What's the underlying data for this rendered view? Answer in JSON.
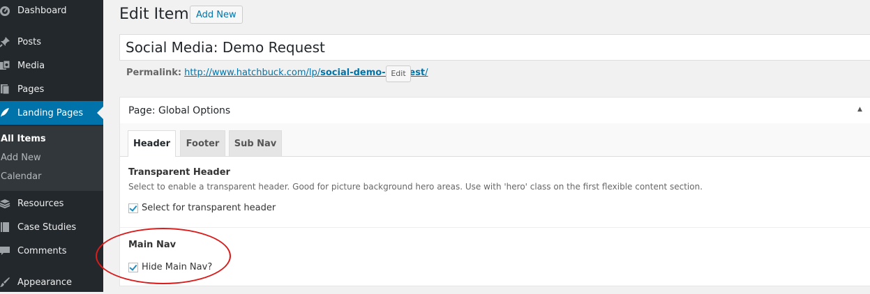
{
  "sidebar": {
    "items": [
      {
        "label": "Dashboard",
        "icon": "dashboard-icon"
      },
      {
        "label": "Posts",
        "icon": "pin-icon"
      },
      {
        "label": "Media",
        "icon": "media-icon"
      },
      {
        "label": "Pages",
        "icon": "pages-icon"
      },
      {
        "label": "Landing Pages",
        "icon": "feather-icon"
      },
      {
        "label": "Resources",
        "icon": "layers-icon"
      },
      {
        "label": "Case Studies",
        "icon": "book-icon"
      },
      {
        "label": "Comments",
        "icon": "comment-icon"
      },
      {
        "label": "Appearance",
        "icon": "brush-icon"
      }
    ],
    "submenu": [
      "All Items",
      "Add New",
      "Calendar"
    ]
  },
  "header": {
    "title": "Edit Item",
    "add_new": "Add New"
  },
  "post": {
    "title_value": "Social Media: Demo Request",
    "permalink_label": "Permalink:",
    "permalink_url": "http://www.hatchbuck.com/lp/",
    "permalink_slug": "social-demo-request",
    "permalink_trailing": "/",
    "edit_label": "Edit"
  },
  "options_box": {
    "title": "Page: Global Options",
    "tabs": [
      "Header",
      "Footer",
      "Sub Nav"
    ],
    "transparent_header": {
      "label": "Transparent Header",
      "description": "Select to enable a transparent header. Good for picture background hero areas. Use with 'hero' class on the first flexible content section.",
      "checkbox_label": "Select for transparent header",
      "checked": true
    },
    "main_nav": {
      "label": "Main Nav",
      "checkbox_label": "Hide Main Nav?",
      "checked": true
    }
  },
  "colors": {
    "sidebar_bg": "#23282d",
    "active_menu": "#0073aa",
    "annotation": "#d91c1c"
  }
}
